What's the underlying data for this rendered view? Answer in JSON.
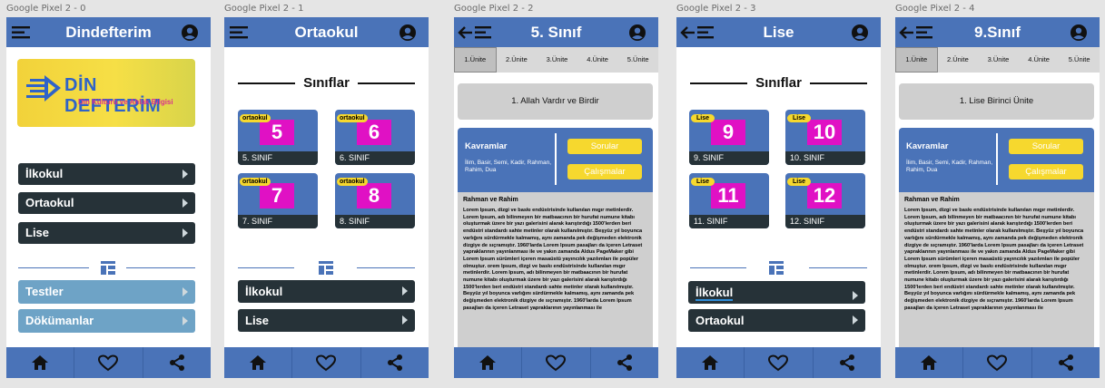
{
  "frames": [
    {
      "label": "Google Pixel 2 - 0",
      "title": "Dindefterim"
    },
    {
      "label": "Google Pixel 2 - 1",
      "title": "Ortaokul"
    },
    {
      "label": "Google Pixel 2 - 2",
      "title": "5. Sınıf"
    },
    {
      "label": "Google Pixel 2 - 3",
      "title": "Lise"
    },
    {
      "label": "Google Pixel 2 - 4",
      "title": "9.Sınıf"
    }
  ],
  "home": {
    "logo_title": "DİN DEFTERİM",
    "logo_subtitle": "Din Kültürü ve Ahlak Bilgisi",
    "menu": [
      "İlkokul",
      "Ortaokul",
      "Lise"
    ],
    "extras": [
      "Testler",
      "Dökümanlar"
    ]
  },
  "ortaokul": {
    "section_title": "Sınıflar",
    "cards": [
      {
        "tag": "ortaokul",
        "num": "5",
        "label": "5. SINIF"
      },
      {
        "tag": "ortaokul",
        "num": "6",
        "label": "6. SINIF"
      },
      {
        "tag": "ortaokul",
        "num": "7",
        "label": "7. SINIF"
      },
      {
        "tag": "ortaokul",
        "num": "8",
        "label": "8. SINIF"
      }
    ],
    "menu": [
      "İlkokul",
      "Lise"
    ]
  },
  "lise": {
    "section_title": "Sınıflar",
    "cards": [
      {
        "tag": "Lise",
        "num": "9",
        "label": "9. SINIF"
      },
      {
        "tag": "Lise",
        "num": "10",
        "label": "10. SINIF"
      },
      {
        "tag": "Lise",
        "num": "11",
        "label": "11. SINIF"
      },
      {
        "tag": "Lise",
        "num": "12",
        "label": "12. SINIF"
      }
    ],
    "menu": [
      "İlkokul",
      "Ortaokul"
    ]
  },
  "unit_page": {
    "tabs": [
      "1.Ünite",
      "2.Ünite",
      "3.Ünite",
      "4.Ünite",
      "5.Ünite"
    ],
    "kavram_title": "Kavramlar",
    "kavram_words": "İlim, Basir, Semi, Kadir, Rahman, Rahim, Dua",
    "sorular": "Sorular",
    "calismalar": "Çalışmalar",
    "reading_title": "Rahman ve Rahim",
    "reading_body": "Lorem Ipsum, dizgi ve baskı endüstrisinde kullanılan mıgır metinlerdir. Lorem Ipsum, adı bilinmeyen bir matbaacının bir hurufat numune kitabı oluşturmak üzere bir yazı galerisini alarak karıştırdığı 1500'lerden beri endüstri standardı sahte metinler olarak kullanılmıştır. Beşyüz yıl boyunca varlığını sürdürmekle kalmamış, aynı zamanda pek değişmeden elektronik dizgiye de sıçramıştır. 1960'larda Lorem Ipsum pasajları da içeren Letraset yapraklarının yayınlanması ile ve yakın zamanda Aldus PageMaker gibi Lorem Ipsum sürümleri içeren masaüstü yayıncılık yazılımları ile popüler olmuştur. orem Ipsum, dizgi ve baskı endüstrisinde kullanılan mıgır metinlerdir. Lorem Ipsum, adı bilinmeyen bir matbaacının bir hurufat numune kitabı oluşturmak üzere bir yazı galerisini alarak karıştırdığı 1500'lerden beri endüstri standardı sahte metinler olarak kullanılmıştır. Beşyüz yıl boyunca varlığını sürdürmekle kalmamış, aynı zamanda pek değişmeden elektronik dizgiye de sıçramıştır. 1960'larda Lorem Ipsum pasajları da içeren Letraset yapraklarının yayınlanması ile"
  },
  "sinif5": {
    "unit_title": "1. Allah Vardır ve Birdir"
  },
  "sinif9": {
    "unit_title": "1. Lise Birinci Ünite"
  },
  "icons": {
    "menu": "hamburger-icon",
    "back": "back-arrow-icon",
    "account": "account-icon",
    "home": "home-icon",
    "favorite": "heart-icon",
    "share": "share-icon",
    "grid": "dashboard-icon"
  },
  "colors": {
    "primary": "#4a73b8",
    "dark": "#263238",
    "accent": "#f6d82e",
    "number_badge": "#e011c4",
    "teal_button": "#6ea3c6"
  }
}
